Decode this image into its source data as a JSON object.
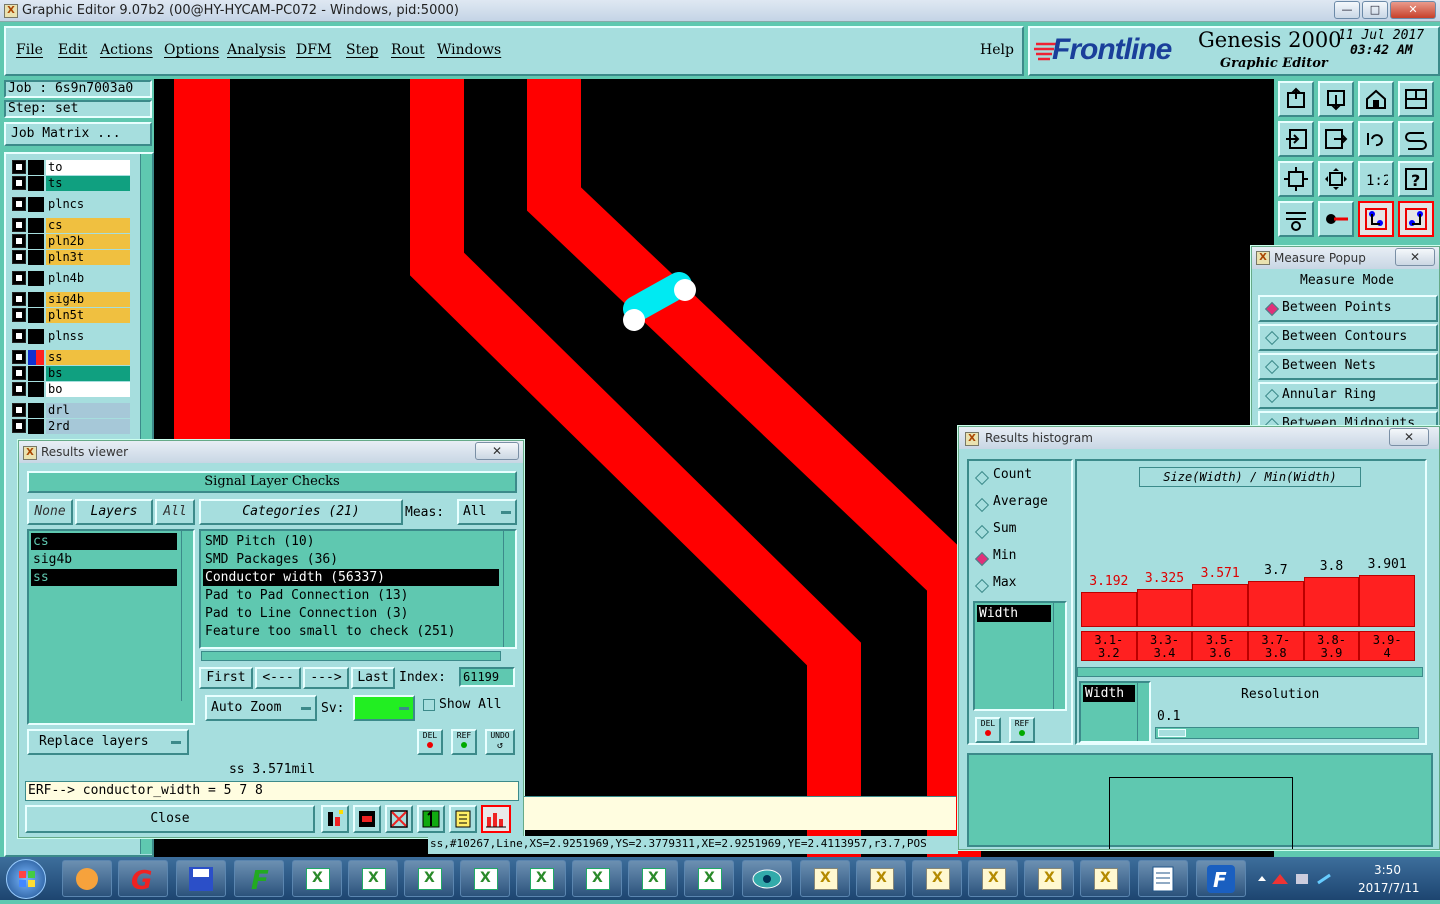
{
  "window": {
    "title": "Graphic Editor 9.07b2 (00@HY-HYCAM-PC072 - Windows, pid:5000)",
    "min": "—",
    "max": "□",
    "close": "✕"
  },
  "menu": {
    "items": [
      "File",
      "Edit",
      "Actions",
      "Options",
      "Analysis",
      "DFM",
      "Step",
      "Rout",
      "Windows"
    ],
    "help": "Help"
  },
  "brand": {
    "logo": "Frontline",
    "product": "Genesis 2000",
    "subtitle": "Graphic Editor",
    "date": "11 Jul 2017",
    "time": "03:42 AM"
  },
  "job": {
    "job_label": "Job  : 6s9n7003a0",
    "step_label": "Step: set",
    "matrix_button": "Job Matrix ..."
  },
  "layers": [
    {
      "name": "to",
      "color": "#ffffff",
      "sq": "#000000"
    },
    {
      "name": "ts",
      "color": "#10a080",
      "sq": "#000000"
    },
    {
      "name": "plncs",
      "color": "#a6dede",
      "sq": "#000000"
    },
    {
      "name": "cs",
      "color": "#f0c040",
      "sq": "#000000"
    },
    {
      "name": "pln2b",
      "color": "#f0c040",
      "sq": "#000000"
    },
    {
      "name": "pln3t",
      "color": "#f0c040",
      "sq": "#000000"
    },
    {
      "name": "pln4b",
      "color": "#a6dede",
      "sq": "#000000"
    },
    {
      "name": "sig4b",
      "color": "#f0c040",
      "sq": "#000000"
    },
    {
      "name": "pln5t",
      "color": "#f0c040",
      "sq": "#000000"
    },
    {
      "name": "plnss",
      "color": "#a6dede",
      "sq": "#000000"
    },
    {
      "name": "ss",
      "color": "#f0c040",
      "sq": "#ff2020"
    },
    {
      "name": "bs",
      "color": "#10a080",
      "sq": "#000000"
    },
    {
      "name": "bo",
      "color": "#ffffff",
      "sq": "#000000"
    },
    {
      "name": "drl",
      "color": "#a6c8d8",
      "sq": "#000000"
    },
    {
      "name": "2rd",
      "color": "#a6c8d8",
      "sq": "#000000"
    }
  ],
  "measure_popup": {
    "title": "Measure Popup",
    "close": "✕",
    "header": "Measure Mode",
    "modes": [
      "Between Points",
      "Between Contours",
      "Between Nets",
      "Annular Ring",
      "Between Midpoints"
    ],
    "selected": 0
  },
  "results_viewer": {
    "title": "Results viewer",
    "close": "✕",
    "group": "Signal Layer Checks",
    "none_btn": "None",
    "layers_btn": "Layers",
    "all_btn": "All",
    "categories_btn": "Categories (21)",
    "meas_label": "Meas:",
    "meas_value": "All",
    "layer_list": [
      {
        "name": "cs",
        "selected": true
      },
      {
        "name": "sig4b",
        "selected": false
      },
      {
        "name": "ss",
        "selected": true
      }
    ],
    "categories": [
      {
        "text": "SMD Pitch (10)",
        "selected": false
      },
      {
        "text": "SMD Packages (36)",
        "selected": false
      },
      {
        "text": "Conductor width (56337)",
        "selected": true
      },
      {
        "text": "Pad to Pad Connection (13)",
        "selected": false
      },
      {
        "text": "Pad to Line Connection (3)",
        "selected": false
      },
      {
        "text": "Feature too small to check (251)",
        "selected": false
      }
    ],
    "first_btn": "First",
    "prev_btn": "<---",
    "next_btn": "--->",
    "last_btn": "Last",
    "index_label": "Index:",
    "index_value": "61199",
    "auto_zoom": "Auto Zoom",
    "sv_label": "Sv:",
    "show_all": "Show All",
    "replace_layers": "Replace layers",
    "del": "DEL",
    "ref": "REF",
    "undo": "UNDO",
    "status": "ss 3.571mil",
    "erf": "ERF--> conductor_width = 5 7 8",
    "close_btn": "Close"
  },
  "histogram": {
    "title": "Results histogram",
    "close": "✕",
    "modes": [
      "Count",
      "Average",
      "Sum",
      "Min",
      "Max"
    ],
    "selected_mode": 3,
    "list": [
      "Width"
    ],
    "chart_title": "Size(Width) / Min(Width)",
    "bars": [
      {
        "value": "3.192",
        "range": "3.1-\n3.2"
      },
      {
        "value": "3.325",
        "range": "3.3-\n3.4"
      },
      {
        "value": "3.571",
        "range": "3.5-\n3.6"
      },
      {
        "value": "3.7",
        "range": "3.7-\n3.8"
      },
      {
        "value": "3.8",
        "range": "3.8-\n3.9"
      },
      {
        "value": "3.901",
        "range": "3.9-\n4"
      }
    ],
    "bar_levels": [
      0.75,
      0.78,
      0.83,
      0.86,
      0.9,
      0.92
    ],
    "bottom_list": "Width",
    "resolution_label": "Resolution",
    "resolution_value": "0.1",
    "del": "DEL",
    "ref": "REF"
  },
  "statusline": "ss,#10267,Line,XS=2.9251969,YS=2.3779311,XE=2.9251969,YE=2.4113957,r3.7,POS",
  "taskbar": {
    "time": "3:50",
    "date": "2017/7/11"
  },
  "colors": {
    "panel": "#a6dede",
    "panel_dark": "#5fc8b0",
    "trace": "#ff0000",
    "highlight": "#00e8f0",
    "sv_green": "#22ee22"
  }
}
